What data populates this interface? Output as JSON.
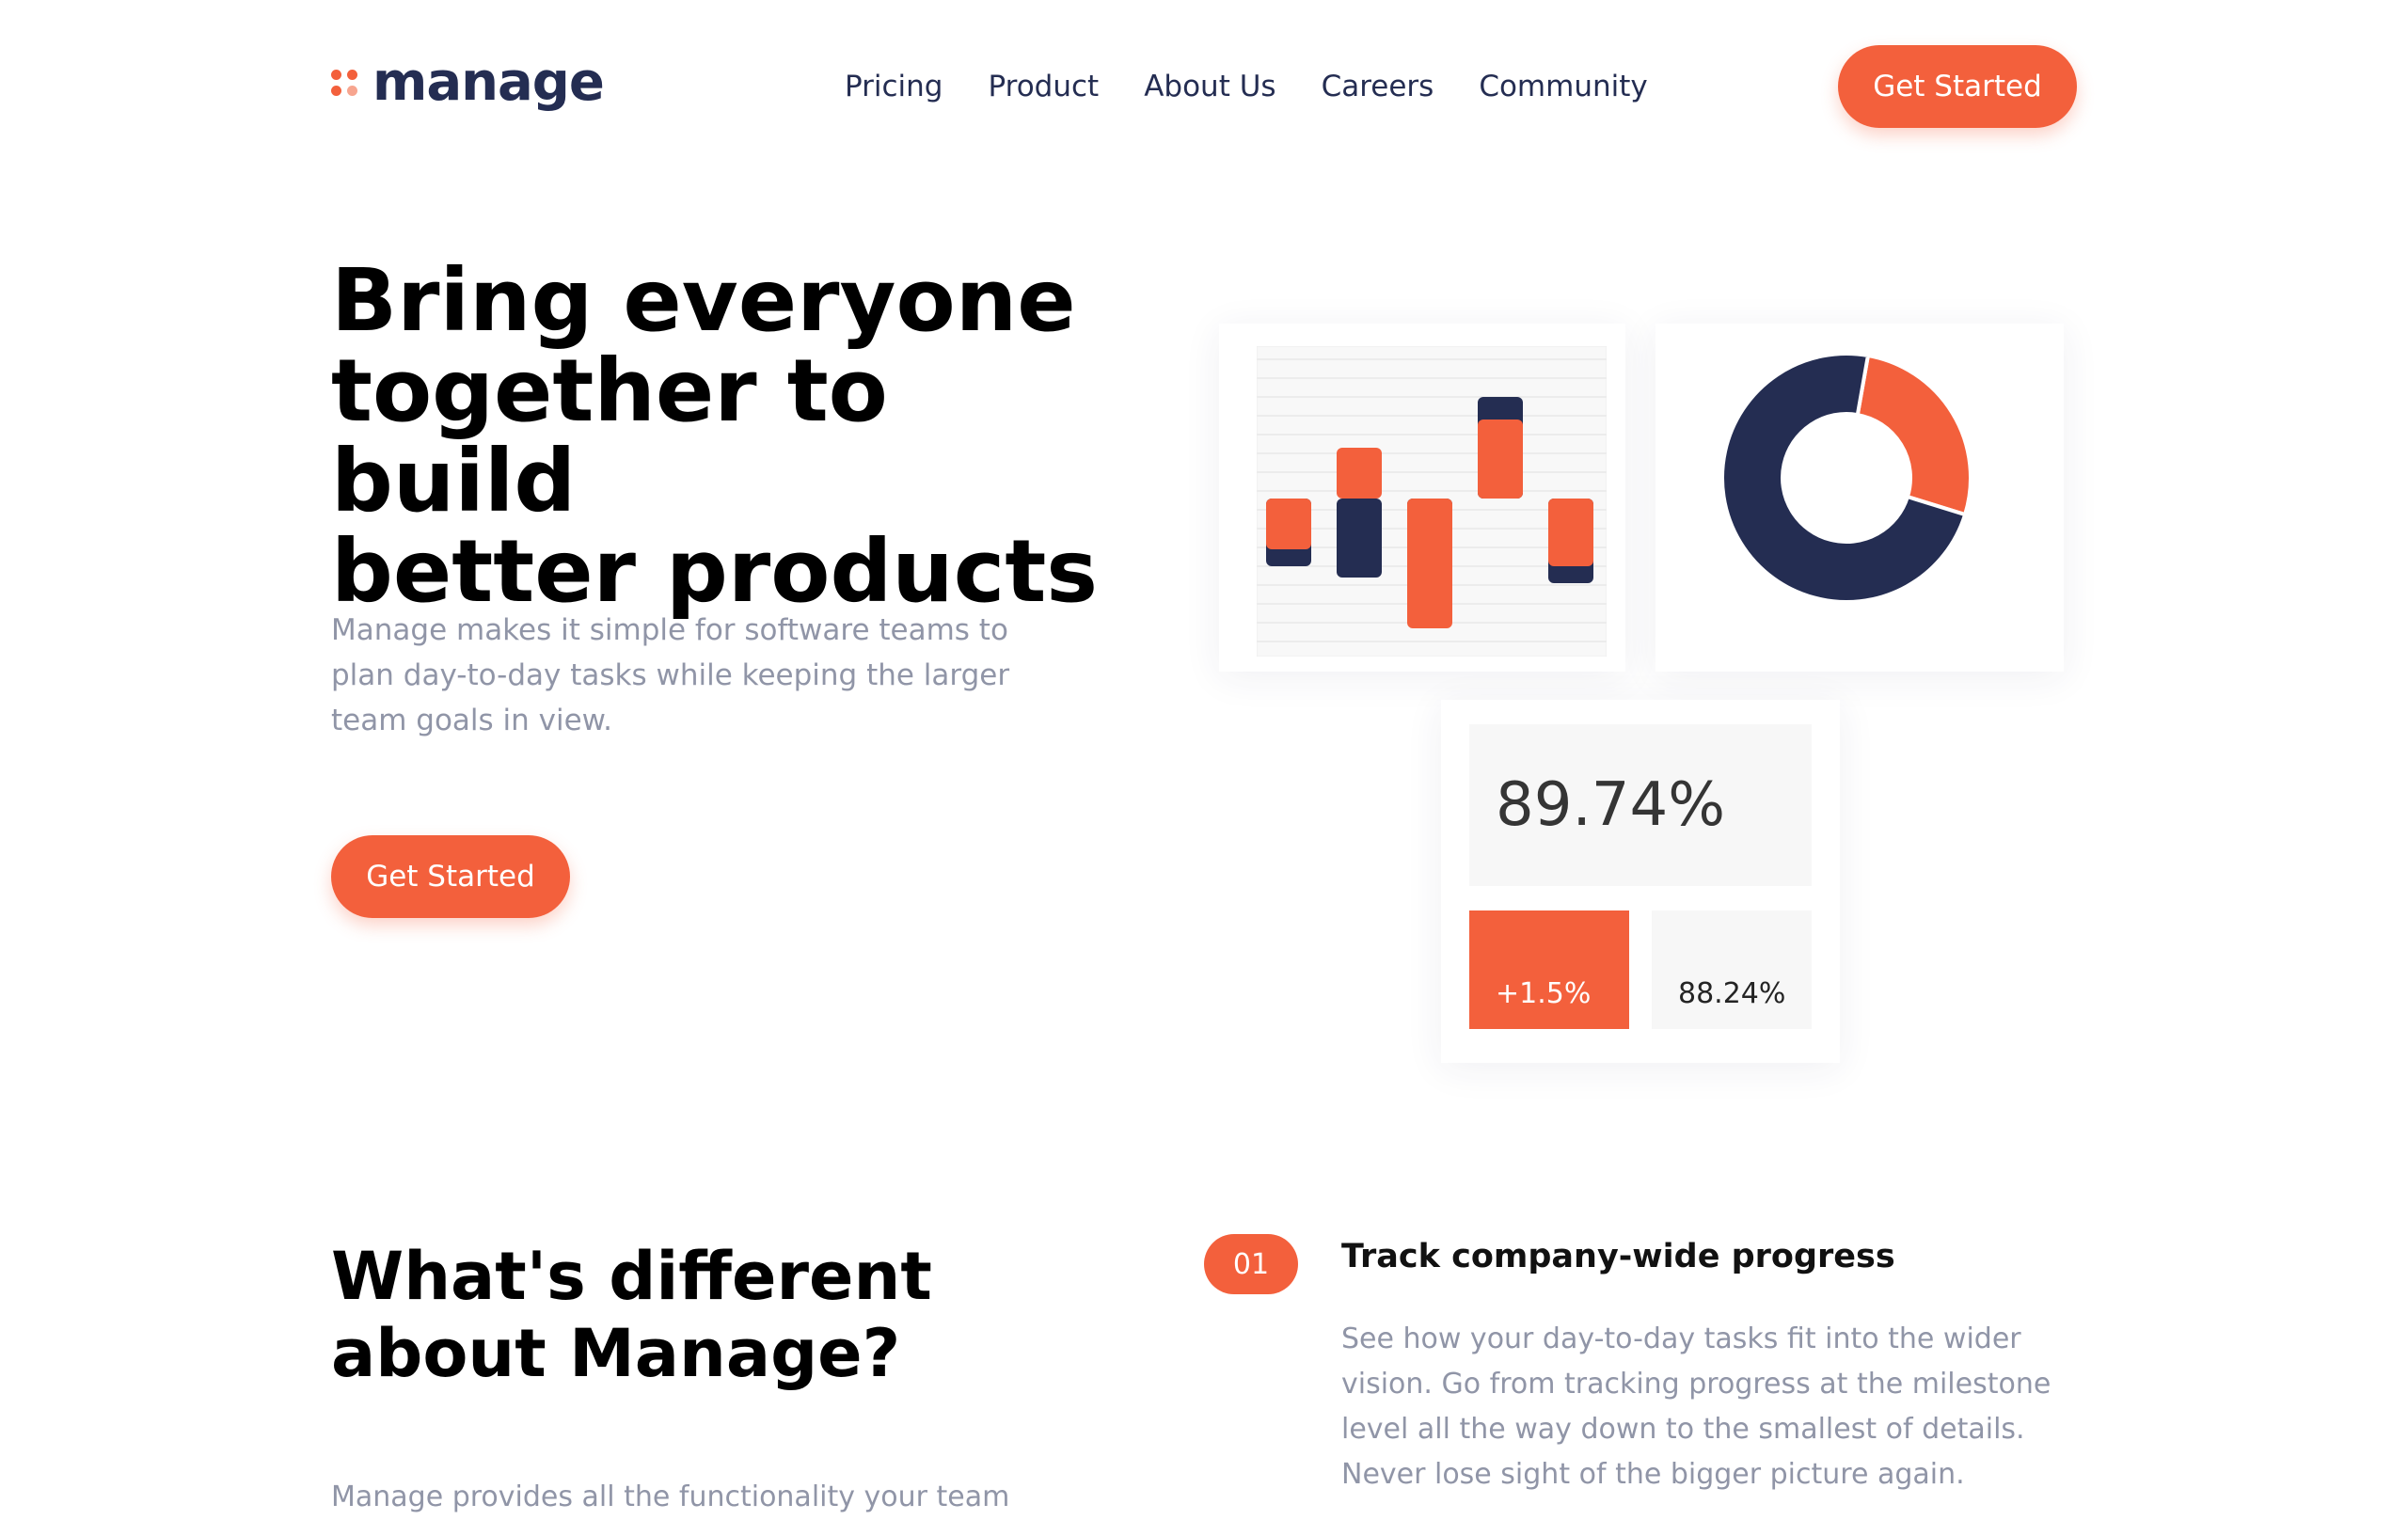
{
  "brand": {
    "name": "manage",
    "colors": {
      "primary": "#f3603c",
      "dark": "#242d52",
      "dot_light": "#f7a58f",
      "muted_text": "#9095a7"
    }
  },
  "nav": {
    "items": [
      {
        "label": "Pricing"
      },
      {
        "label": "Product"
      },
      {
        "label": "About Us"
      },
      {
        "label": "Careers"
      },
      {
        "label": "Community"
      }
    ],
    "cta_label": "Get Started"
  },
  "hero": {
    "title_lines": [
      "Bring everyone",
      "together to build",
      "better products"
    ],
    "description": "Manage makes it simple for software teams to plan day-to-day tasks while keeping the larger team goals in view.",
    "cta_label": "Get Started"
  },
  "illustration": {
    "bar_chart": {
      "bars": [
        {
          "dark": -1.2,
          "orange": -0.9
        },
        {
          "dark": -1.4,
          "orange": 0.9
        },
        {
          "dark": -0.9,
          "orange": -2.3
        },
        {
          "dark": 1.8,
          "orange": 1.4
        },
        {
          "dark": -1.5,
          "orange": -1.2
        }
      ]
    },
    "donut": {
      "segments": [
        {
          "share": 0.27,
          "color": "#f3603c"
        },
        {
          "share": 0.73,
          "color": "#242d52"
        }
      ]
    },
    "stats": {
      "main_value": "89.74%",
      "change": "+1.5%",
      "secondary_value": "88.24%"
    }
  },
  "features": {
    "heading": "What's different about Manage?",
    "description": "Manage provides all the functionality your team",
    "items": [
      {
        "number": "01",
        "title": "Track company-wide progress",
        "description": "See how your day-to-day tasks fit into the wider vision. Go from tracking progress at the milestone level all the way down to the smallest of details. Never lose sight of the bigger picture again."
      }
    ]
  }
}
